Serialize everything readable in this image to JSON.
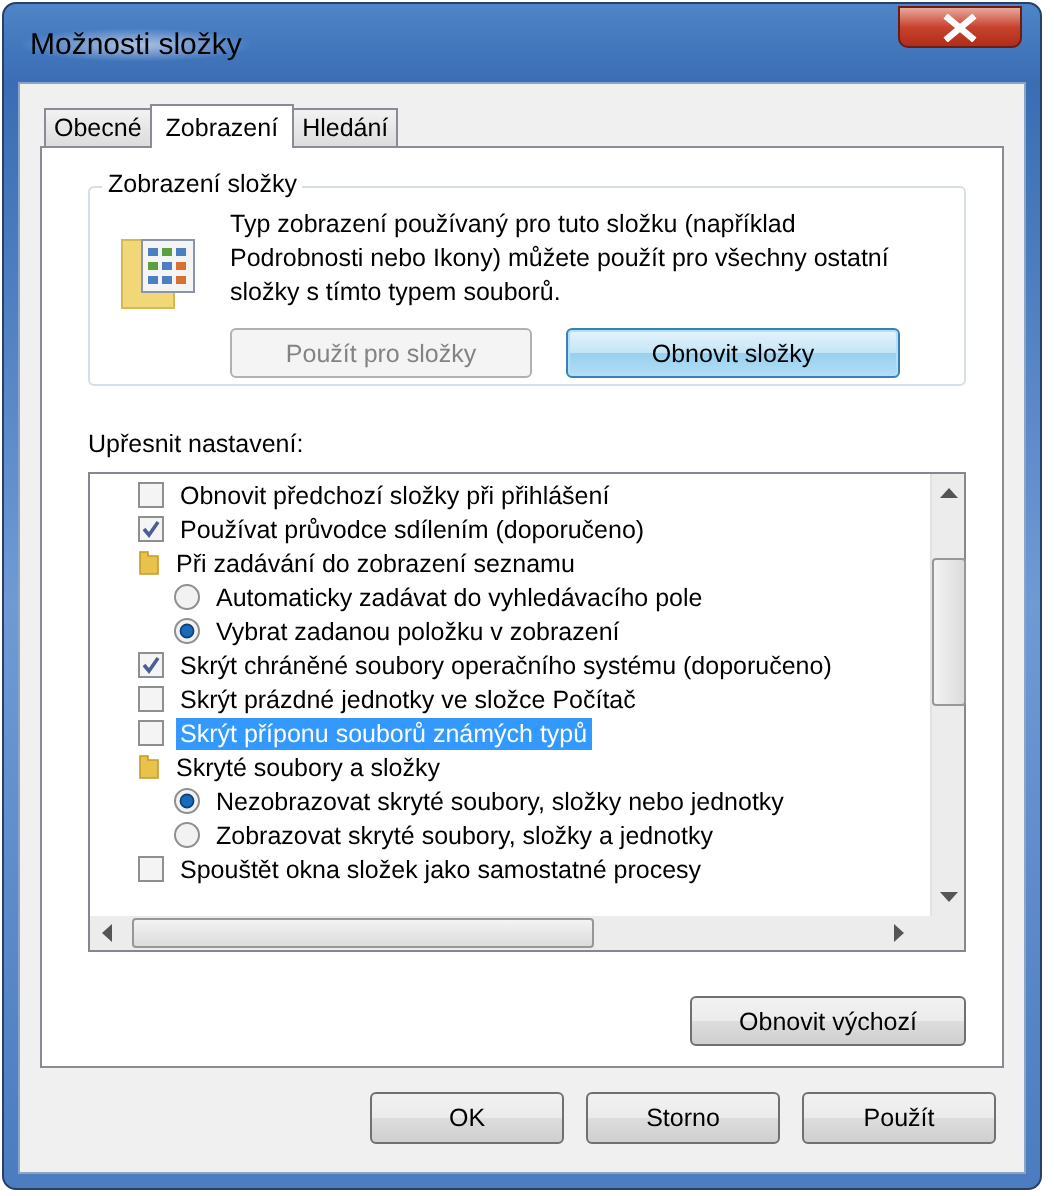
{
  "window": {
    "title": "Možnosti složky"
  },
  "tabs": [
    {
      "label": "Obecné",
      "selected": false
    },
    {
      "label": "Zobrazení",
      "selected": true
    },
    {
      "label": "Hledání",
      "selected": false
    }
  ],
  "folder_views": {
    "title": "Zobrazení složky",
    "description": "Typ zobrazení používaný pro tuto složku (například Podrobnosti nebo Ikony) můžete použít pro všechny ostatní složky s tímto typem souborů.",
    "buttons": [
      {
        "label": "Použít pro složky",
        "disabled": true,
        "default": false
      },
      {
        "label": "Obnovit složky",
        "disabled": false,
        "default": true
      }
    ]
  },
  "advanced": {
    "label": "Upřesnit nastavení:",
    "items": [
      {
        "kind": "checkbox",
        "label": "Obnovit předchozí složky při přihlášení",
        "checked": false,
        "selected": false
      },
      {
        "kind": "checkbox",
        "label": "Používat průvodce sdílením (doporučeno)",
        "checked": true,
        "selected": false
      },
      {
        "kind": "folder",
        "label": "Při zadávání do zobrazení seznamu",
        "selected": false,
        "children": [
          {
            "kind": "radio",
            "label": "Automaticky zadávat do vyhledávacího pole",
            "checked": false,
            "selected": false
          },
          {
            "kind": "radio",
            "label": "Vybrat zadanou položku v zobrazení",
            "checked": true,
            "selected": false
          }
        ]
      },
      {
        "kind": "checkbox",
        "label": "Skrýt chráněné soubory operačního systému (doporučeno)",
        "checked": true,
        "selected": false
      },
      {
        "kind": "checkbox",
        "label": "Skrýt prázdné jednotky ve složce Počítač",
        "checked": false,
        "selected": false
      },
      {
        "kind": "checkbox",
        "label": "Skrýt příponu souborů známých typů",
        "checked": false,
        "selected": true
      },
      {
        "kind": "folder",
        "label": "Skryté soubory a složky",
        "selected": false,
        "children": [
          {
            "kind": "radio",
            "label": "Nezobrazovat skryté soubory, složky nebo jednotky",
            "checked": true,
            "selected": false
          },
          {
            "kind": "radio",
            "label": "Zobrazovat skryté soubory, složky a jednotky",
            "checked": false,
            "selected": false
          }
        ]
      },
      {
        "kind": "checkbox",
        "label": "Spouštět okna složek jako samostatné procesy",
        "checked": false,
        "selected": false
      }
    ]
  },
  "restore_button": "Obnovit výchozí",
  "buttons": [
    {
      "label": "OK"
    },
    {
      "label": "Storno"
    },
    {
      "label": "Použít"
    }
  ]
}
